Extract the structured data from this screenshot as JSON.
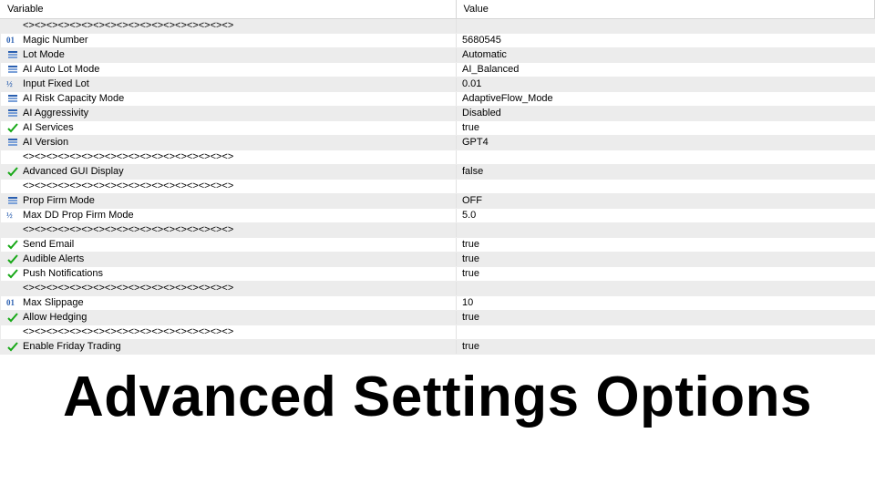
{
  "headers": {
    "variable": "Variable",
    "value": "Value"
  },
  "section_divider": "<><><><><><><><><><><><><><><><><><>",
  "title": "Advanced Settings Options",
  "rows": [
    {
      "icon": "none",
      "label_key": "section_divider",
      "value": ""
    },
    {
      "icon": "int",
      "label": "Magic Number",
      "value": "5680545"
    },
    {
      "icon": "enum",
      "label": "Lot Mode",
      "value": "Automatic"
    },
    {
      "icon": "enum",
      "label": "AI Auto Lot Mode",
      "value": "AI_Balanced"
    },
    {
      "icon": "double",
      "label": "Input  Fixed Lot",
      "value": "0.01"
    },
    {
      "icon": "enum",
      "label": "AI Risk Capacity Mode",
      "value": "AdaptiveFlow_Mode"
    },
    {
      "icon": "enum",
      "label": "AI Aggressivity",
      "value": "Disabled"
    },
    {
      "icon": "bool",
      "label": "AI Services",
      "value": "true"
    },
    {
      "icon": "enum",
      "label": "AI Version",
      "value": "GPT4"
    },
    {
      "icon": "none",
      "label_key": "section_divider",
      "value": ""
    },
    {
      "icon": "bool",
      "label": "Advanced GUI Display",
      "value": "false"
    },
    {
      "icon": "none",
      "label_key": "section_divider",
      "value": ""
    },
    {
      "icon": "enum",
      "label": "Prop Firm Mode",
      "value": "OFF"
    },
    {
      "icon": "double",
      "label": "Max DD Prop Firm Mode",
      "value": "5.0"
    },
    {
      "icon": "none",
      "label_key": "section_divider",
      "value": ""
    },
    {
      "icon": "bool",
      "label": "Send Email",
      "value": "true"
    },
    {
      "icon": "bool",
      "label": "Audible Alerts",
      "value": "true"
    },
    {
      "icon": "bool",
      "label": "Push Notifications",
      "value": "true"
    },
    {
      "icon": "none",
      "label_key": "section_divider",
      "value": ""
    },
    {
      "icon": "int",
      "label": "Max Slippage",
      "value": "10"
    },
    {
      "icon": "bool",
      "label": "Allow Hedging",
      "value": "true"
    },
    {
      "icon": "none",
      "label_key": "section_divider",
      "value": ""
    },
    {
      "icon": "bool",
      "label": "Enable Friday Trading",
      "value": "true"
    }
  ]
}
